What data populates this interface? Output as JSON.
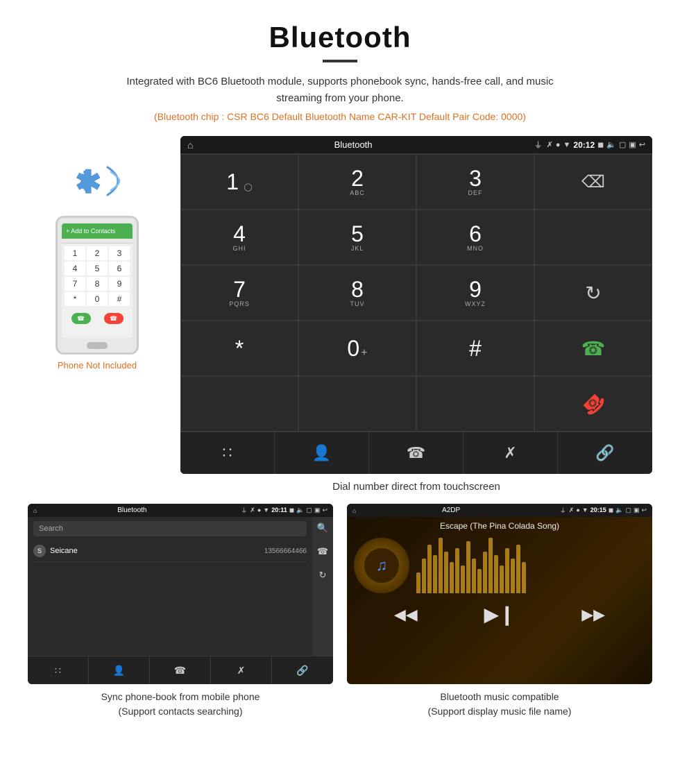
{
  "header": {
    "title": "Bluetooth",
    "description": "Integrated with BC6 Bluetooth module, supports phonebook sync, hands-free call, and music streaming from your phone.",
    "specs": "(Bluetooth chip : CSR BC6    Default Bluetooth Name CAR-KIT    Default Pair Code: 0000)"
  },
  "phone_label": "Phone Not Included",
  "dial_screen": {
    "status_bar": {
      "title": "Bluetooth",
      "time": "20:12"
    },
    "keys": [
      {
        "num": "1",
        "sub": ""
      },
      {
        "num": "2",
        "sub": "ABC"
      },
      {
        "num": "3",
        "sub": "DEF"
      },
      {
        "num": "",
        "sub": ""
      },
      {
        "num": "4",
        "sub": "GHI"
      },
      {
        "num": "5",
        "sub": "JKL"
      },
      {
        "num": "6",
        "sub": "MNO"
      },
      {
        "num": "",
        "sub": ""
      },
      {
        "num": "7",
        "sub": "PQRS"
      },
      {
        "num": "8",
        "sub": "TUV"
      },
      {
        "num": "9",
        "sub": "WXYZ"
      },
      {
        "num": "",
        "sub": "refresh"
      },
      {
        "num": "*",
        "sub": ""
      },
      {
        "num": "0",
        "sub": "+"
      },
      {
        "num": "#",
        "sub": ""
      },
      {
        "num": "",
        "sub": "call_green"
      },
      {
        "num": "",
        "sub": "call_red"
      }
    ],
    "toolbar": [
      "grid",
      "person",
      "phone",
      "bluetooth",
      "link"
    ]
  },
  "dial_caption": "Dial number direct from touchscreen",
  "phonebook_screen": {
    "status_bar": {
      "title": "Bluetooth",
      "time": "20:11"
    },
    "search_placeholder": "Search",
    "contacts": [
      {
        "letter": "S",
        "name": "Seicane",
        "number": "13566664466"
      }
    ],
    "toolbar": [
      "grid",
      "person",
      "phone",
      "bluetooth",
      "link"
    ]
  },
  "phonebook_caption": "Sync phone-book from mobile phone\n(Support contacts searching)",
  "music_screen": {
    "status_bar": {
      "title": "A2DP",
      "time": "20:15"
    },
    "song_title": "Escape (The Pina Colada Song)",
    "controls": [
      "prev",
      "play-pause",
      "next"
    ],
    "viz_bars": [
      30,
      50,
      70,
      55,
      80,
      60,
      45,
      65,
      40,
      75,
      50,
      35,
      60,
      80,
      55,
      40,
      65,
      50,
      70,
      45
    ]
  },
  "music_caption": "Bluetooth music compatible\n(Support display music file name)"
}
